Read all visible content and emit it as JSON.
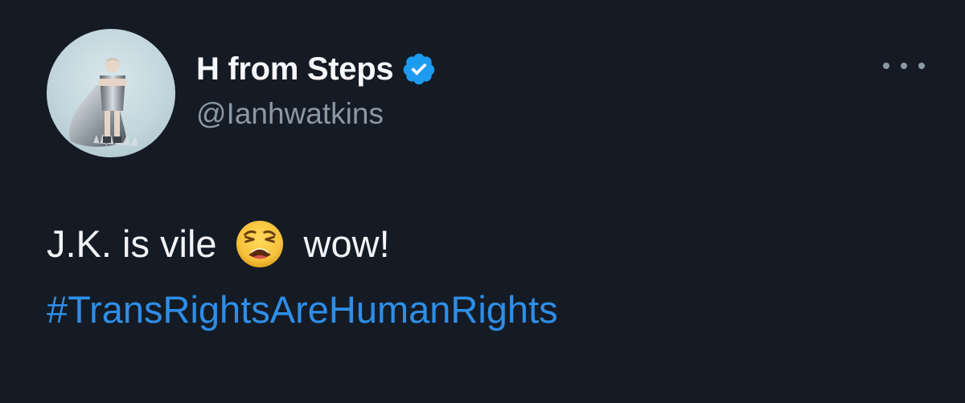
{
  "tweet": {
    "author": {
      "display_name": "H from Steps",
      "handle": "@Ianhwatkins",
      "verified": true,
      "avatar_icon": "profile-photo"
    },
    "more_icon": "ellipsis-icon",
    "text": {
      "before_emoji": "J.K. is vile",
      "emoji": "😩",
      "after_emoji": "wow!",
      "hashtag": "#TransRightsAreHumanRights"
    },
    "colors": {
      "background": "#151b24",
      "text": "#f2f4f7",
      "secondary_text": "#8b98a5",
      "link": "#2e8ee8",
      "verified_badge": "#1d9bf0"
    }
  }
}
